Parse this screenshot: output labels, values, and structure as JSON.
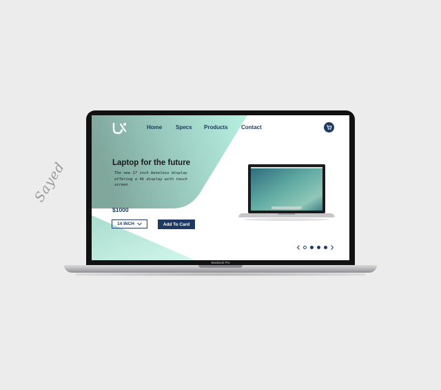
{
  "signature": "Sayed",
  "nav": {
    "items": [
      "Home",
      "Specs",
      "Products",
      "Contact"
    ]
  },
  "hero": {
    "title": "Laptop for the future",
    "description": "The new 17 inch beseless display offering a 4k display with touch screen",
    "price": "$1000",
    "size_option": "14 INCH",
    "add_button": "Add To Card"
  },
  "carousel": {
    "total_dots": 4,
    "active_dot_index": 0
  },
  "device_label": "MacBook Pro",
  "colors": {
    "primary": "#1f3a62",
    "hero_gradient_light": "#b4efe0",
    "hero_gradient_dark": "#7fa79c"
  },
  "icons": {
    "logo": "ux-logo-icon",
    "cart": "cart-icon",
    "dropdown": "chevron-down-icon",
    "prev": "chevron-left-icon",
    "next": "chevron-right-icon"
  }
}
